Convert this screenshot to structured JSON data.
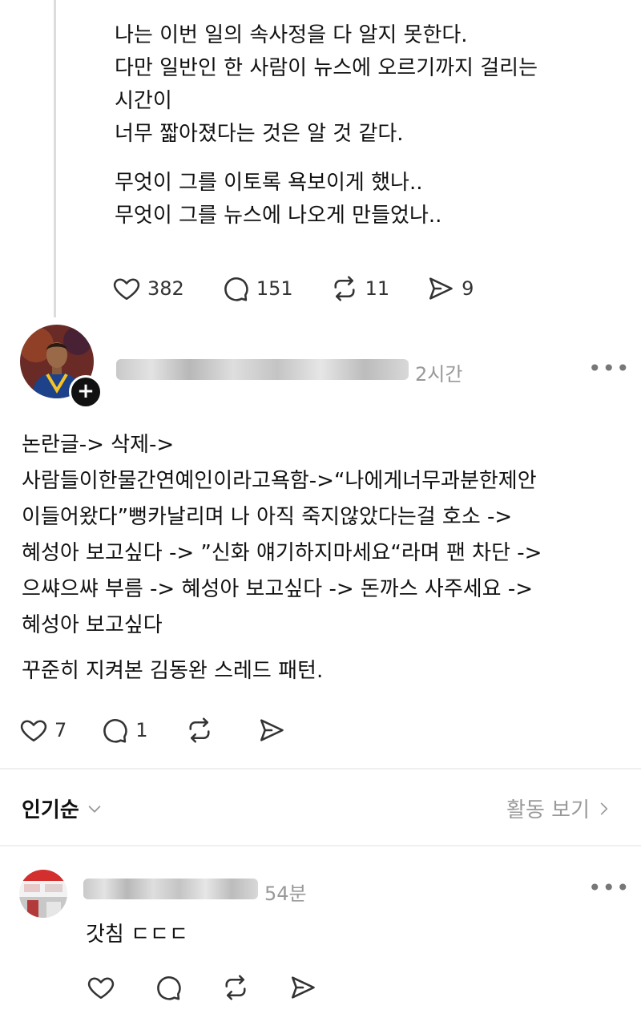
{
  "post1": {
    "lines_a": [
      "나는 이번 일의 속사정을 다 알지 못한다.",
      "다만 일반인 한 사람이 뉴스에 오르기까지 걸리는",
      "시간이",
      "너무 짧아졌다는 것은 알 것 같다."
    ],
    "lines_b": [
      "무엇이 그를 이토록 욕보이게 했나..",
      "무엇이 그를 뉴스에 나오게 만들었나.."
    ],
    "likes": "382",
    "comments": "151",
    "reposts": "11",
    "shares": "9"
  },
  "post2": {
    "time": "2시간",
    "lines_a": [
      "논란글-> 삭제->",
      "사람들이한물간연예인이라고욕함->“나에게너무과분한제안",
      "이들어왔다”뻥카날리며 나 아직 죽지않았다는걸 호소 ->",
      "혜성아 보고싶다 -> ”신화 얘기하지마세요“라며 팬 차단 ->",
      "으쌰으쌰 부름 -> 혜성아 보고싶다 -> 돈까스 사주세요 ->",
      "혜성아 보고싶다"
    ],
    "lines_b": [
      "꾸준히 지켜본 김동완 스레드 패턴."
    ],
    "likes": "7",
    "comments": "1"
  },
  "sort_bar": {
    "sort_label": "인기순",
    "activity_label": "활동 보기"
  },
  "reply": {
    "time": "54분",
    "text": "갓침 ㄷㄷㄷ"
  },
  "more_label": "•••",
  "icons": [
    "heart-icon",
    "comment-icon",
    "repost-icon",
    "send-icon",
    "plus-icon",
    "chevron-down-icon",
    "chevron-right-icon",
    "more-icon"
  ]
}
